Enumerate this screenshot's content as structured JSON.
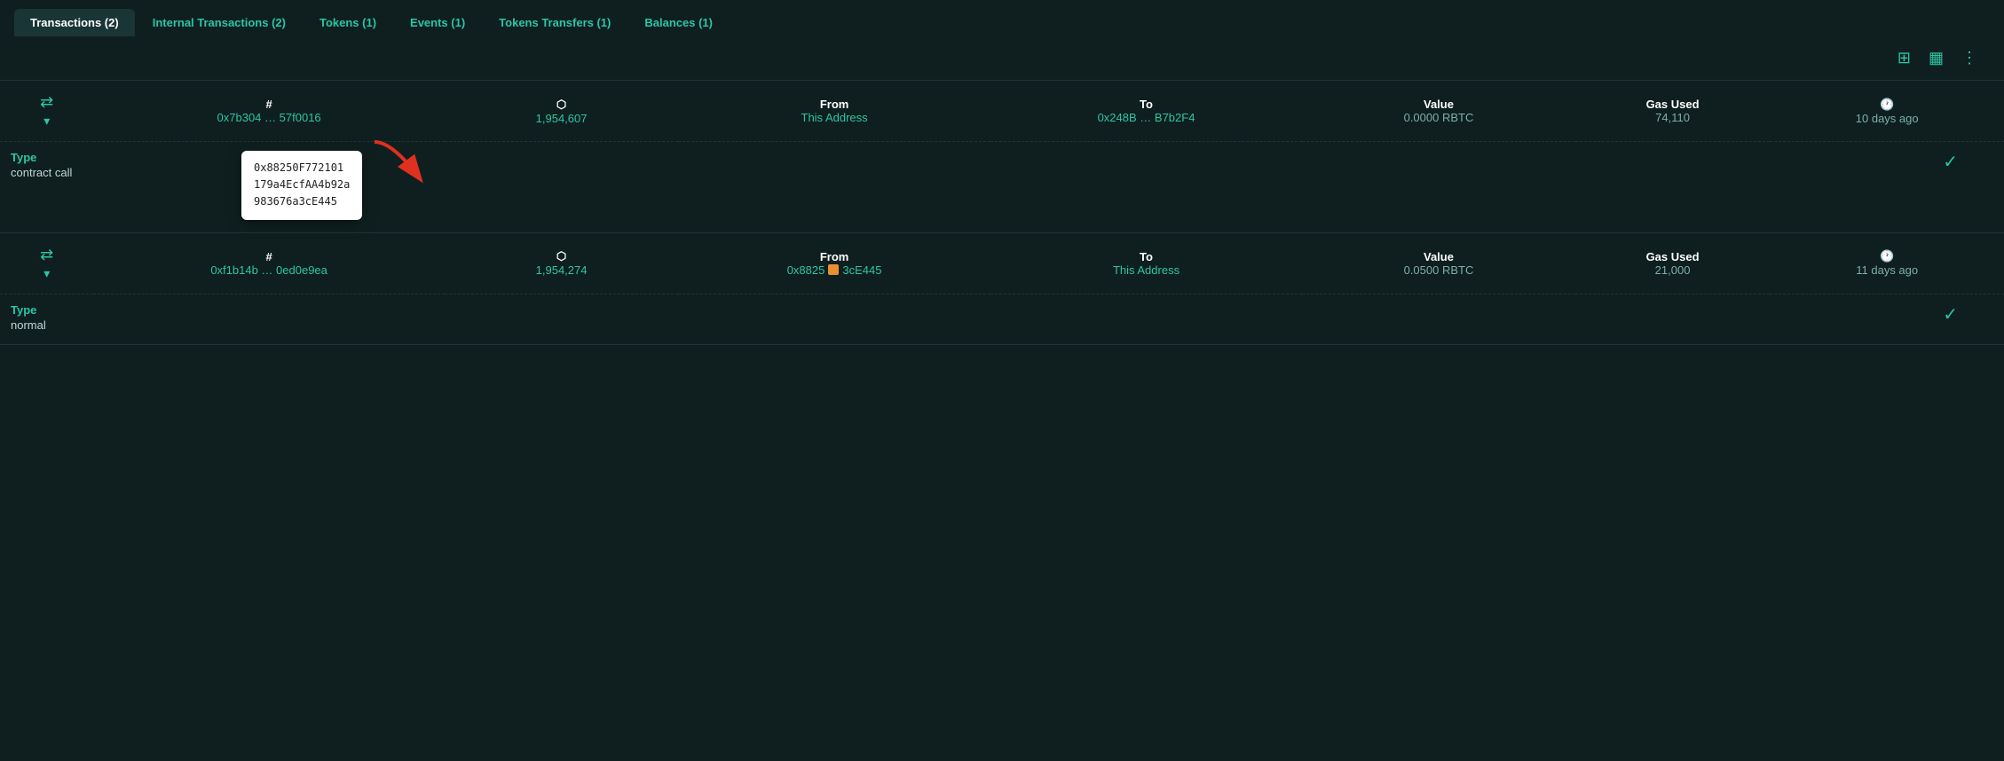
{
  "tabs": [
    {
      "id": "transactions",
      "label": "Transactions (2)",
      "active": true
    },
    {
      "id": "internal",
      "label": "Internal Transactions (2)",
      "active": false
    },
    {
      "id": "tokens",
      "label": "Tokens (1)",
      "active": false
    },
    {
      "id": "events",
      "label": "Events (1)",
      "active": false
    },
    {
      "id": "token-transfers",
      "label": "Tokens Transfers (1)",
      "active": false
    },
    {
      "id": "balances",
      "label": "Balances (1)",
      "active": false
    }
  ],
  "toolbar": {
    "grid_icon": "⊞",
    "table_icon": "▦",
    "more_icon": "⋮"
  },
  "columns": {
    "hash": "#",
    "block": "⬡",
    "from": "From",
    "to": "To",
    "value": "Value",
    "gas": "Gas Used",
    "time_icon": "🕐"
  },
  "row1": {
    "hash_start": "0x7b304 …",
    "hash_end": "57f0016",
    "block": "1,954,607",
    "from_label": "From",
    "from_value": "This Address",
    "to_start": "0x248B …",
    "to_end": "B7b2F4",
    "value": "0.0000 RBTC",
    "gas": "74,110",
    "time": "10 days ago",
    "type_label": "Type",
    "type_value": "contract call"
  },
  "row2": {
    "hash_start": "0xf1b14b …",
    "hash_end": "0ed0e9ea",
    "block": "1,954,274",
    "from_start": "0x8825",
    "from_end": "3cE445",
    "to_label": "To",
    "to_value": "This Address",
    "value": "0.0500 RBTC",
    "gas": "21,000",
    "time": "11 days ago",
    "type_label": "Type",
    "type_value": "normal"
  },
  "tooltip": {
    "line1": "0x88250F772101",
    "line2": "179a4EcfAA4b92a",
    "line3": "983676a3cE445"
  }
}
